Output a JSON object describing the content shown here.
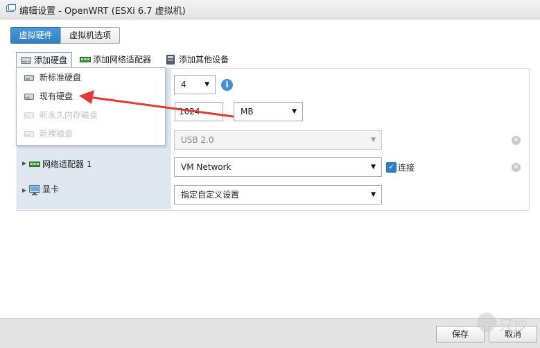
{
  "window": {
    "title": "编辑设置 - OpenWRT (ESXi 6.7 虚拟机)"
  },
  "tabs": [
    {
      "label": "虚拟硬件",
      "active": true
    },
    {
      "label": "虚拟机选项",
      "active": false
    }
  ],
  "toolbar": {
    "add_disk": "添加硬盘",
    "add_network_adapter": "添加网络适配器",
    "add_other_device": "添加其他设备"
  },
  "add_disk_menu": {
    "items": [
      {
        "label": "新标准硬盘",
        "enabled": true
      },
      {
        "label": "现有硬盘",
        "enabled": true
      },
      {
        "label": "新永久内存磁盘",
        "enabled": false
      },
      {
        "label": "新裸磁盘",
        "enabled": false
      }
    ]
  },
  "hardware": {
    "cpu": {
      "value": "4"
    },
    "memory": {
      "value": "1024",
      "unit": "MB"
    },
    "usb_controller": {
      "value": "USB 2.0"
    },
    "network_adapter": {
      "label": "网络适配器 1",
      "network": "VM Network",
      "connect_label": "连接",
      "connected": true
    },
    "video_card": {
      "label": "显卡",
      "setting": "指定自定义设置"
    }
  },
  "footer": {
    "save": "保存",
    "cancel": "取消"
  },
  "watermark": {
    "text": "只抄"
  },
  "colors": {
    "accent": "#2f7fc3",
    "label_column_bg": "#dfe8f0",
    "annotation_arrow": "#e53935",
    "footer_bg": "#e4e4e4"
  }
}
